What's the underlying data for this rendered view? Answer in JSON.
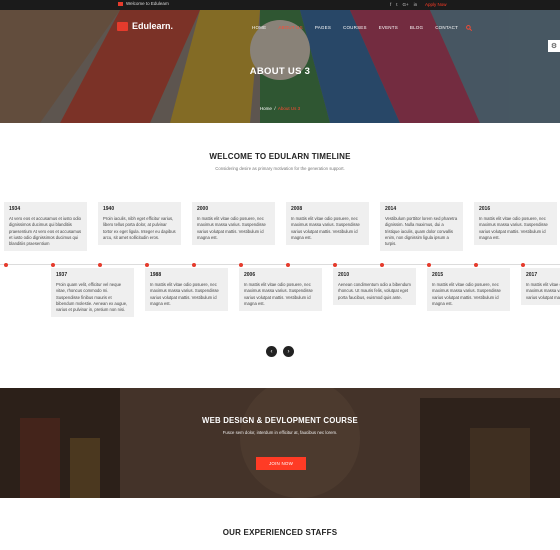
{
  "topbar": {
    "welcome": "Welcome to Edulearn",
    "social": [
      "f",
      "t",
      "G+",
      "in"
    ],
    "apply": "Apply Now"
  },
  "header": {
    "logo": "Edulearn.",
    "nav": [
      "HOME",
      "ABOUT US",
      "PAGES",
      "COURSES",
      "EVENTS",
      "BLOG",
      "CONTACT"
    ],
    "active_nav": "ABOUT US"
  },
  "hero": {
    "title": "ABOUT US 3",
    "breadcrumb_home": "Home",
    "breadcrumb_current": "About Us 3"
  },
  "timeline": {
    "title": "WELCOME TO EDULARN TIMELINE",
    "subtitle": "Considering desire as primary motivation for the generation support.",
    "top": [
      {
        "year": "1934",
        "text": "At vero eos et accusamus et iusto odio dignissimos ducimus qui blanditiis praesentium At vero eos et accusamus et iusto odio dignissimos ducimus qui blanditiis praesentium"
      },
      {
        "year": "1940",
        "text": "Proin iaculis, nibh eget efficitur varius, libero tellus porta dolor, at pulvinar tortor ex eget ligula. Integer eu dapibus arcu, sit amet sollicitudin eros."
      },
      {
        "year": "2000",
        "text": "In mattis elit vitae odio posuere, nec maximus massa varius. Suspendisse varius volutpat mattis. Vestibulum id magna est."
      },
      {
        "year": "2008",
        "text": "In mattis elit vitae odio posuere, nec maximus massa varius. Suspendisse varius volutpat mattis. Vestibulum id magna est."
      },
      {
        "year": "2014",
        "text": "Vestibulum porttitor lorem sed pharetra dignissim. Nulla maximus, dui a tristique iaculis, quam dolor convallis enim, non dignissim ligula ipsum a turpis."
      },
      {
        "year": "2016",
        "text": "In mattis elit vitae odio posuere, nec maximus massa varius. Suspendisse varius volutpat mattis. Vestibulum id magna est."
      }
    ],
    "bottom": [
      {
        "year": "1937",
        "text": "Proin quam velit, efficitur vel neque vitae, rhoncus commodo mi. Suspendisse finibus mauris et bibendum molestie. Aenean ex augue, varius et pulvinar in, pretium non nisi."
      },
      {
        "year": "1988",
        "text": "In mattis elit vitae odio posuere, nec maximus massa varius. Suspendisse varius volutpat mattis. Vestibulum id magna est."
      },
      {
        "year": "2006",
        "text": "In mattis elit vitae odio posuere, nec maximus massa varius. Suspendisse varius volutpat mattis. Vestibulum id magna est."
      },
      {
        "year": "2010",
        "text": "Aenean condimentum odio a bibendum rhoncus. Ut mauris felis, volutpat eget porta faucibus, euismod quis ante."
      },
      {
        "year": "2015",
        "text": "In mattis elit vitae odio posuere, nec maximus massa varius. Suspendisse varius volutpat mattis. Vestibulum id magna est."
      },
      {
        "year": "2017",
        "text": "In mattis elit vitae odio posuere, nec maximus massa varius. Suspendisse varius volutpat mattis."
      }
    ],
    "prev_icon": "chevron-left-icon",
    "next_icon": "chevron-right-icon"
  },
  "course": {
    "title": "WEB DESIGN & DEVLOPMENT COURSE",
    "subtitle": "Fusce sem dolor, interdum in efficitur at, faucibus nec lorem.",
    "button": "JOIN NOW"
  },
  "staff": {
    "title": "OUR EXPERIENCED STAFFS"
  },
  "colors": {
    "accent": "#ff3b25",
    "dark": "#1b1b1b",
    "card": "#efefef"
  }
}
